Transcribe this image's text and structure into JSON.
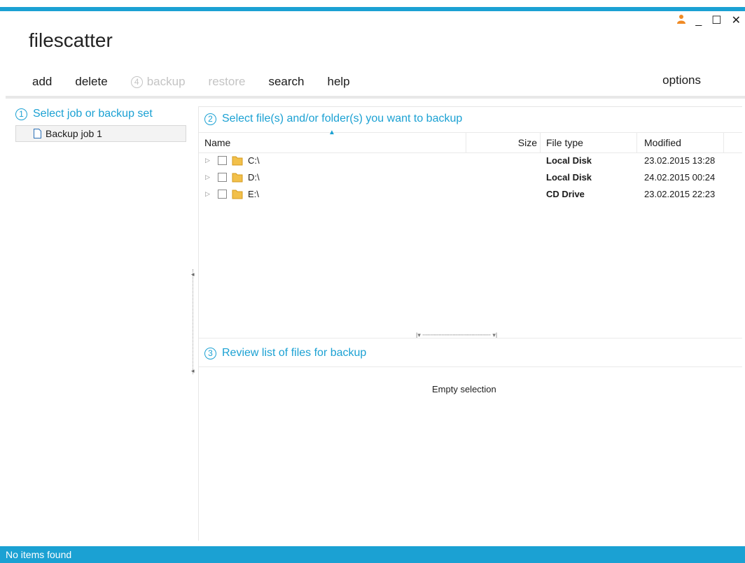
{
  "app": {
    "title": "filescatter",
    "accent_color": "#1ba1d3"
  },
  "window_controls": {
    "user_icon": "user-icon",
    "minimize": "_",
    "maximize": "☐",
    "close": "✕"
  },
  "toolbar": {
    "add": "add",
    "delete": "delete",
    "backup_step": "4",
    "backup": "backup",
    "restore": "restore",
    "search": "search",
    "help": "help",
    "options": "options"
  },
  "left_panel": {
    "step": "1",
    "heading": "Select job or backup set",
    "jobs": [
      {
        "label": "Backup job 1"
      }
    ]
  },
  "file_panel": {
    "step": "2",
    "heading": "Select file(s) and/or folder(s) you want to backup",
    "columns": {
      "name": "Name",
      "size": "Size",
      "type": "File type",
      "modified": "Modified"
    },
    "rows": [
      {
        "name": "C:\\",
        "type": "Local Disk",
        "modified": "23.02.2015 13:28"
      },
      {
        "name": "D:\\",
        "type": "Local Disk",
        "modified": "24.02.2015 00:24"
      },
      {
        "name": "E:\\",
        "type": "CD Drive",
        "modified": "23.02.2015 22:23"
      }
    ]
  },
  "review_panel": {
    "step": "3",
    "heading": "Review list of files for backup",
    "empty_text": "Empty selection"
  },
  "status": {
    "text": "No items found"
  }
}
